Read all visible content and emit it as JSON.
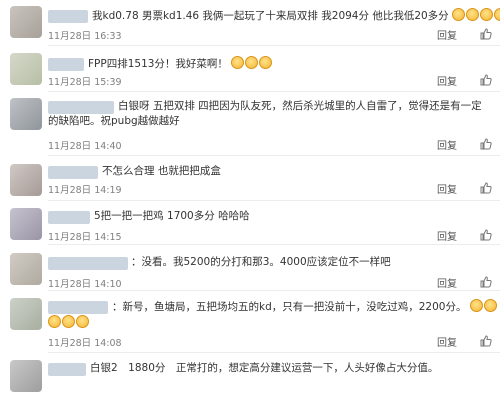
{
  "reply_label": "回复",
  "comments": [
    {
      "content": "我kd0.78 男票kd1.46 我俩一起玩了十来局双排 我2094分 他比我低20多分",
      "emoji_count": 5,
      "time": "11月28日 16:33"
    },
    {
      "content": "FPP四排1513分！我好菜啊！",
      "emoji_count": 3,
      "time": "11月28日 15:39"
    },
    {
      "content": "白银呀 五把双排 四把因为队友死，然后杀光城里的人自雷了，觉得还是有一定的缺陷吧。祝pubg越做越好",
      "emoji_count": 0,
      "time": "11月28日 14:40"
    },
    {
      "content": "不怎么合理 也就把把成盒",
      "emoji_count": 0,
      "time": "11月28日 14:19"
    },
    {
      "content": "5把一把一把鸡 1700多分 哈哈哈",
      "emoji_count": 0,
      "time": "11月28日 14:15"
    },
    {
      "content": "：没看。我5200的分打和那3。4000应该定位不一样吧",
      "emoji_count": 0,
      "time": "11月28日 14:10"
    },
    {
      "content": "：新号，鱼塘局，五把场均五的kd，只有一把没前十，没吃过鸡，2200分。",
      "emoji_count": 5,
      "time": "11月28日 14:08"
    },
    {
      "content": "白银2　1880分　正常打的，想定高分建议运营一下，人头好像占大分值。",
      "emoji_count": 0,
      "time": ""
    }
  ]
}
